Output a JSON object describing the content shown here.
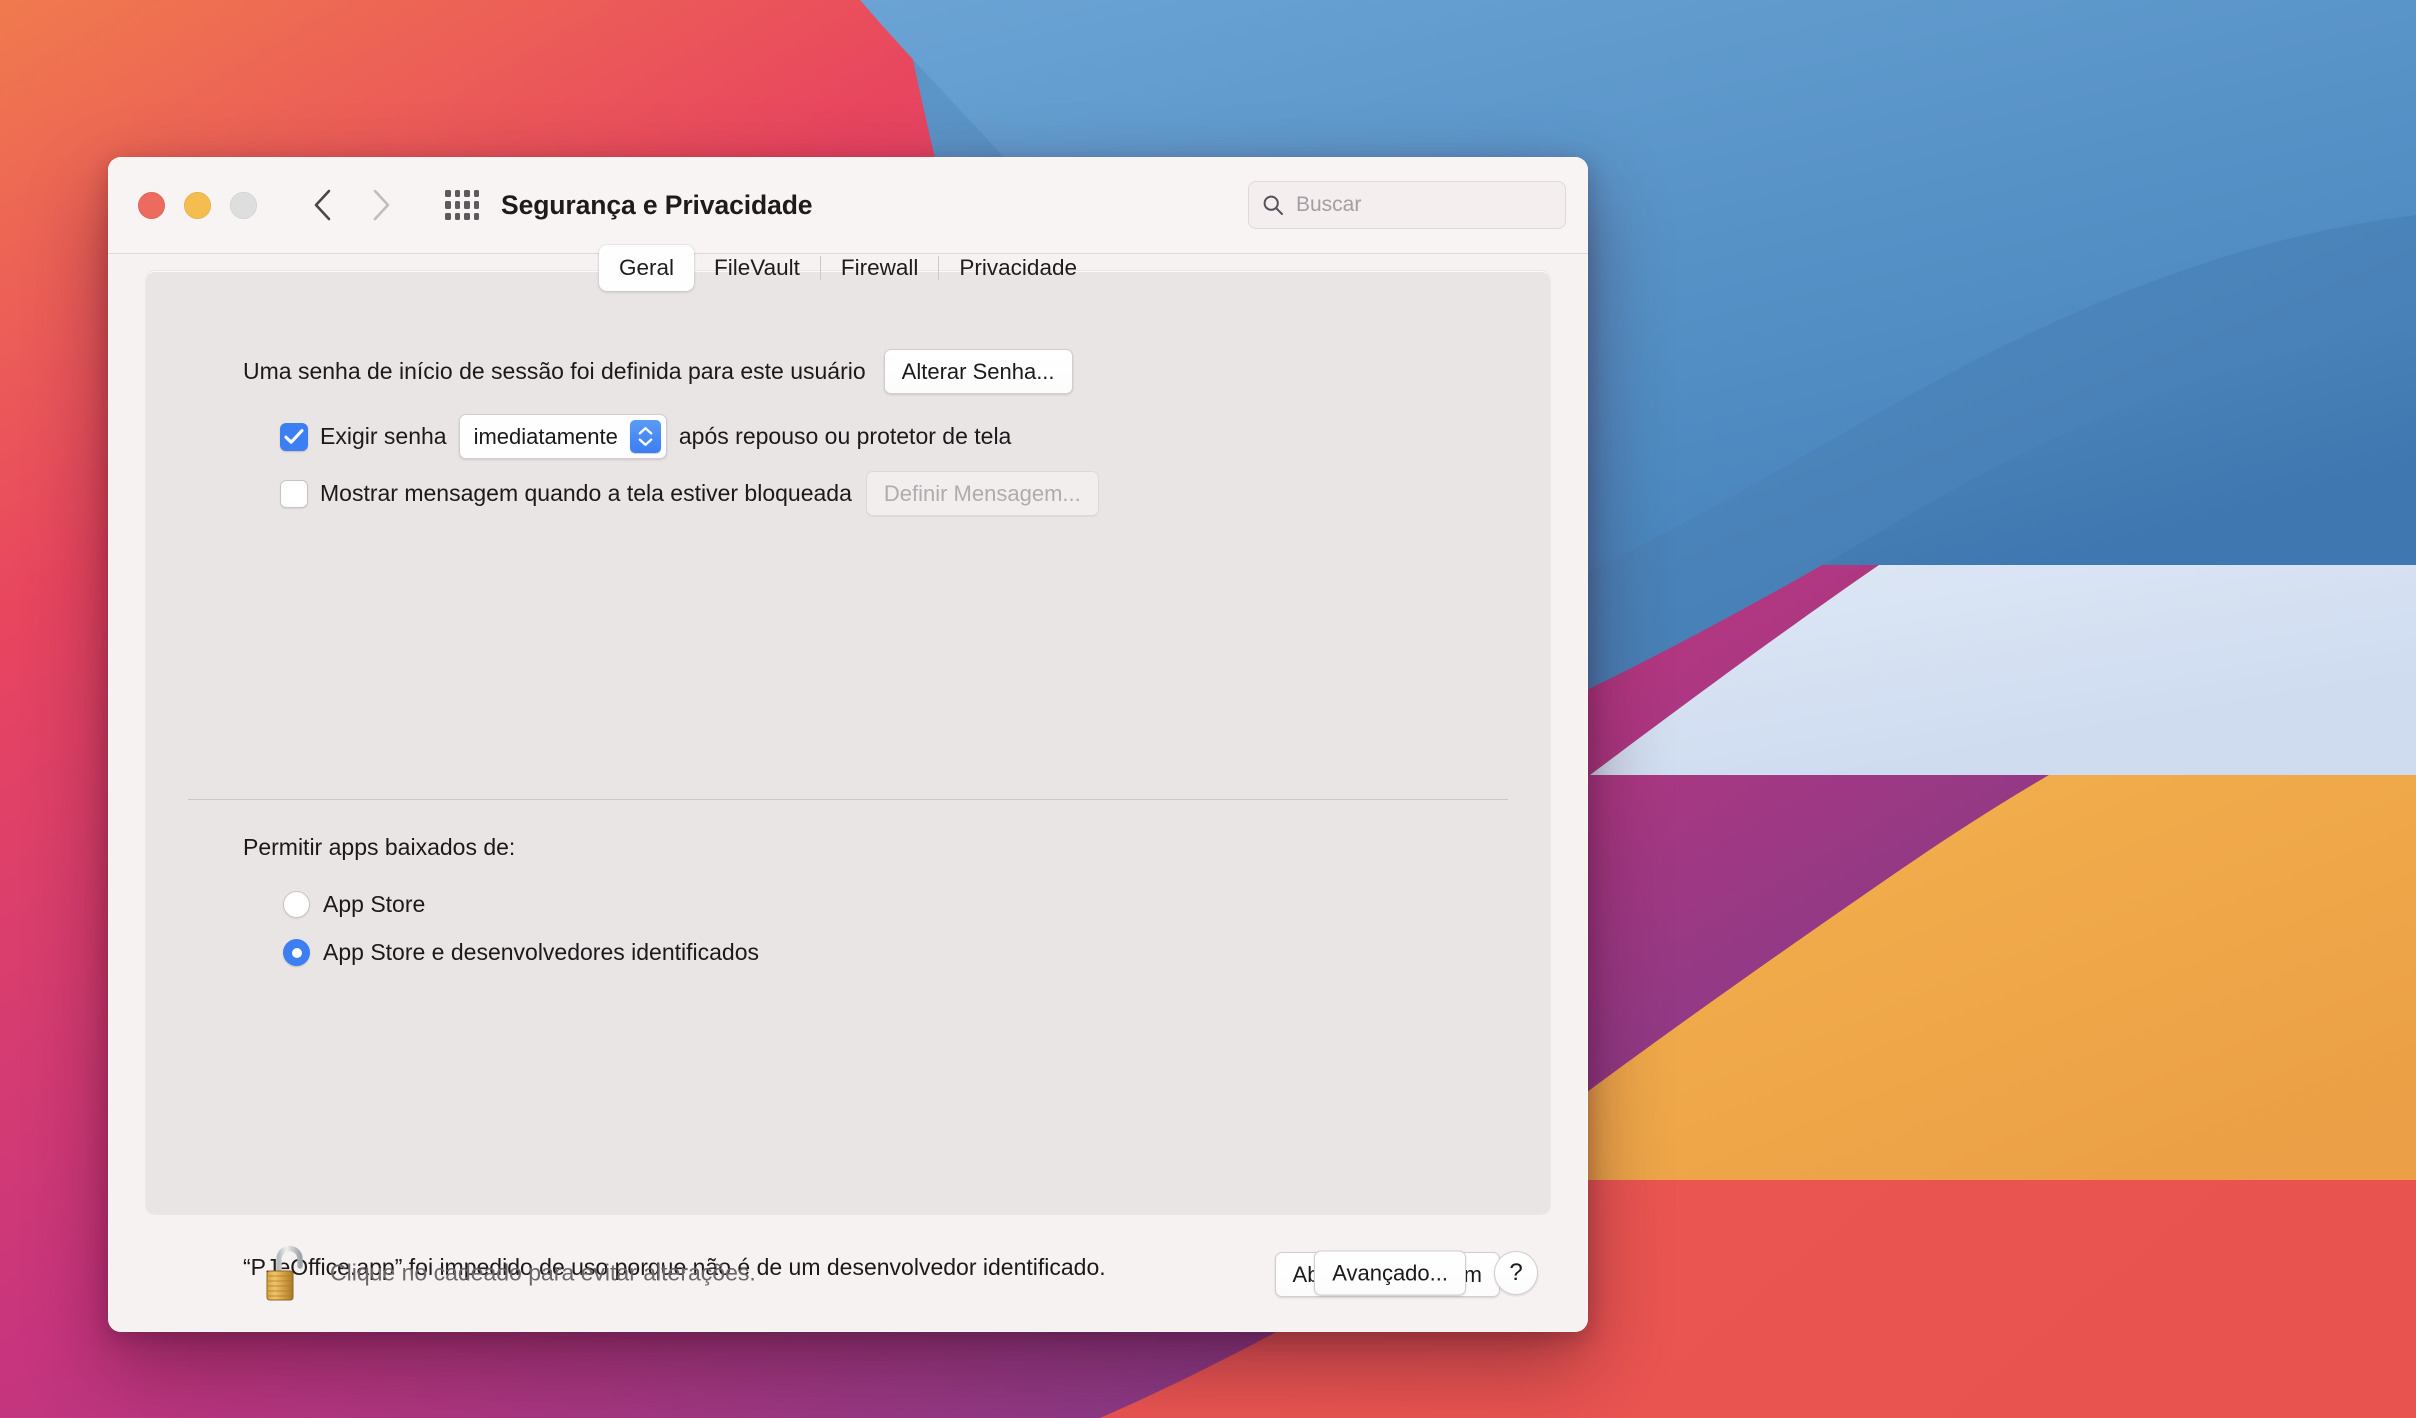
{
  "window": {
    "title": "Segurança e Privacidade",
    "traffic_lights": [
      "close-button",
      "minimize-button",
      "zoom-button"
    ],
    "nav": {
      "back": "back-chevron",
      "forward": "forward-chevron"
    },
    "show_all_icon": "grid-icon",
    "search": {
      "placeholder": "Buscar",
      "value": "",
      "icon": "search-icon"
    }
  },
  "tabs": [
    {
      "label": "Geral",
      "active": true
    },
    {
      "label": "FileVault",
      "active": false
    },
    {
      "label": "Firewall",
      "active": false
    },
    {
      "label": "Privacidade",
      "active": false
    }
  ],
  "general": {
    "password_set_text": "Uma senha de início de sessão foi definida para este usuário",
    "change_password_label": "Alterar Senha...",
    "require_password": {
      "checked": true,
      "label_before": "Exigir senha",
      "delay_value": "imediatamente",
      "label_after": "após repouso ou protetor de tela"
    },
    "show_message": {
      "checked": false,
      "label": "Mostrar mensagem quando a tela estiver bloqueada",
      "button_label": "Definir Mensagem...",
      "button_disabled": true
    }
  },
  "gatekeeper": {
    "title": "Permitir apps baixados de:",
    "options": [
      {
        "label": "App Store",
        "selected": false
      },
      {
        "label": "App Store e desenvolvedores identificados",
        "selected": true
      }
    ],
    "blocked_message": "“PJeOffice.app” foi impedido de uso porque não é de um desenvolvedor identificado.",
    "open_anyway_label": "Abrir Mesmo Assim"
  },
  "footer": {
    "lock_icon": "open-padlock-icon",
    "lock_text": "Clique no cadeado para evitar alterações.",
    "advanced_label": "Avançado...",
    "help_label": "?"
  },
  "colors": {
    "accent_blue": "#3c7ff2",
    "window_bg": "#f7f2f2",
    "panel_bg": "#eae5e5",
    "traffic_red": "#ed6a5e",
    "traffic_yellow": "#f5bd4f",
    "traffic_grey": "#dedede"
  }
}
